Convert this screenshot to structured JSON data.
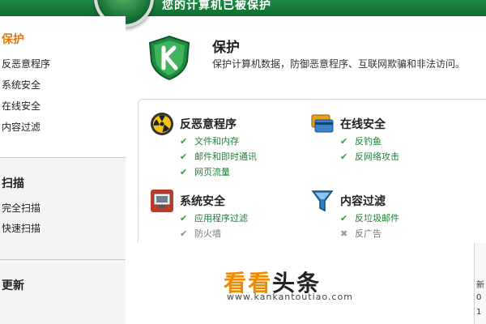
{
  "app": {
    "banner_title": "您的计算机已被保护"
  },
  "sidebar": {
    "protection": {
      "heading": "保护",
      "items": [
        "反恶意程序",
        "系统安全",
        "在线安全",
        "内容过滤"
      ]
    },
    "scan": {
      "heading": "扫描",
      "items": [
        "完全扫描",
        "快速扫描"
      ]
    },
    "update": {
      "heading": "更新"
    }
  },
  "header": {
    "title": "保护",
    "description": "保护计算机数据，防御恶意程序、互联网欺骗和非法访问。"
  },
  "groups": {
    "antimalware": {
      "title": "反恶意程序",
      "features": [
        "文件和内存",
        "邮件和即时通讯",
        "网页流量"
      ]
    },
    "online": {
      "title": "在线安全",
      "features": [
        "反钓鱼",
        "反网络攻击"
      ]
    },
    "system": {
      "title": "系统安全",
      "features": [
        "应用程序过滤",
        "防火墙"
      ]
    },
    "content": {
      "title": "内容过滤",
      "features": [
        "反垃圾邮件",
        "反广告"
      ]
    }
  },
  "watermark": {
    "text_a": "看看",
    "text_b": "头条",
    "url": "www.kankantoutiao.com"
  },
  "right_strip": {
    "lines": [
      "新",
      "0",
      "1"
    ]
  },
  "colors": {
    "brand_green": "#0f6a31",
    "accent_orange": "#e07a10",
    "feature_green": "#1f7f3a"
  }
}
